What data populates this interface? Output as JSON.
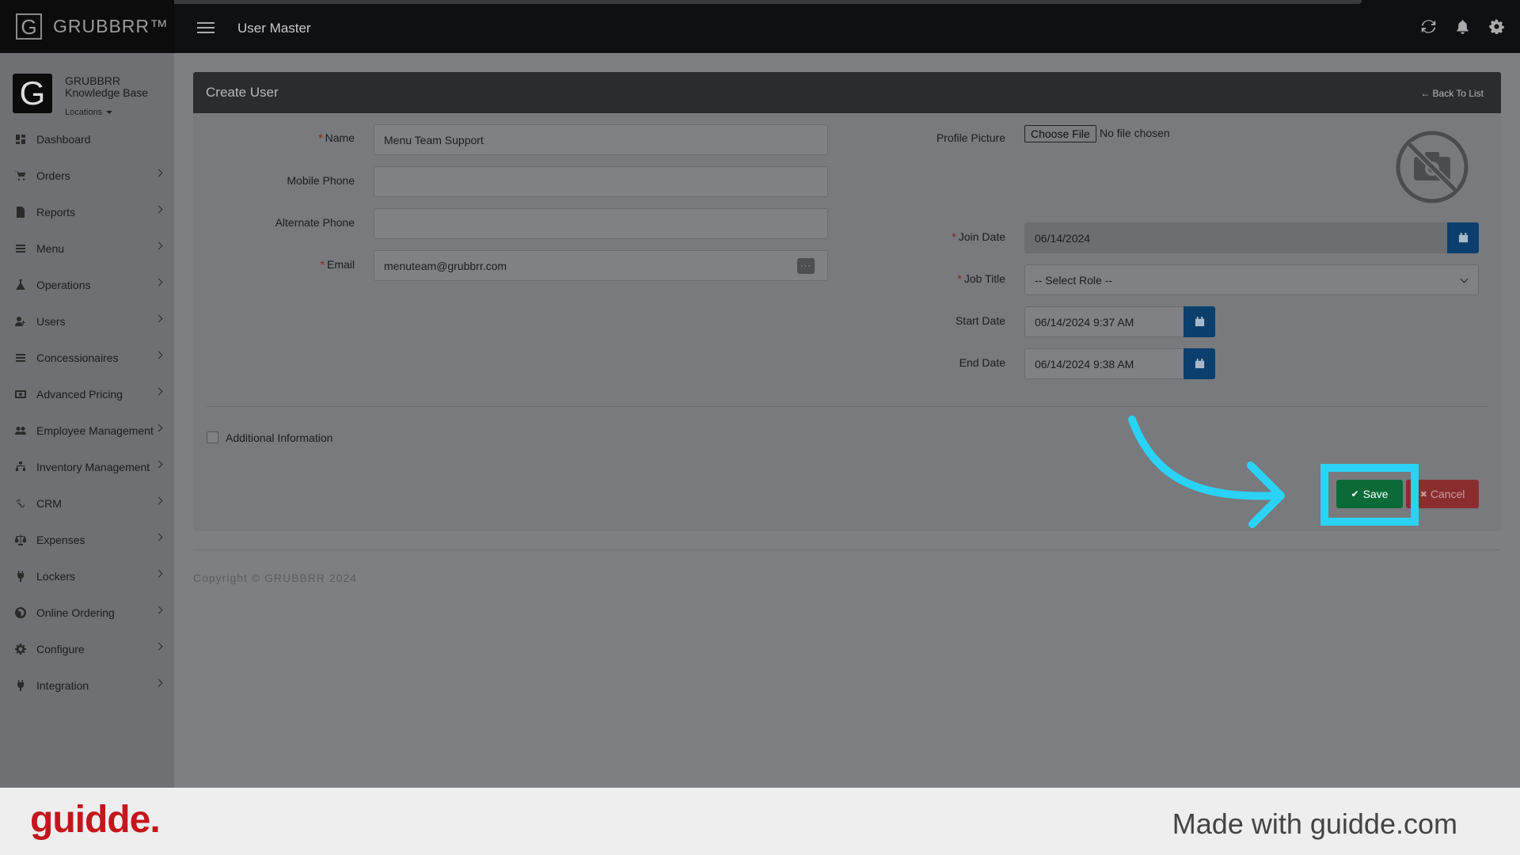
{
  "app": {
    "brand": "GRUBBRR™",
    "brand_letter": "G",
    "page_title": "User Master"
  },
  "profile": {
    "name_line1": "GRUBBRR",
    "name_line2": "Knowledge Base",
    "locations_label": "Locations"
  },
  "sidebar": {
    "items": [
      {
        "label": "Dashboard",
        "icon": "dashboard-icon",
        "has_children": false
      },
      {
        "label": "Orders",
        "icon": "cart-icon",
        "has_children": true
      },
      {
        "label": "Reports",
        "icon": "report-icon",
        "has_children": true
      },
      {
        "label": "Menu",
        "icon": "list-icon",
        "has_children": true
      },
      {
        "label": "Operations",
        "icon": "flask-icon",
        "has_children": true
      },
      {
        "label": "Users",
        "icon": "user-plus-icon",
        "has_children": true
      },
      {
        "label": "Concessionaires",
        "icon": "list-icon",
        "has_children": true
      },
      {
        "label": "Advanced Pricing",
        "icon": "money-icon",
        "has_children": true
      },
      {
        "label": "Employee Management",
        "icon": "users-icon",
        "has_children": true
      },
      {
        "label": "Inventory Management",
        "icon": "sitemap-icon",
        "has_children": true
      },
      {
        "label": "CRM",
        "icon": "link-icon",
        "has_children": true
      },
      {
        "label": "Expenses",
        "icon": "scale-icon",
        "has_children": true
      },
      {
        "label": "Lockers",
        "icon": "plug-icon",
        "has_children": true
      },
      {
        "label": "Online Ordering",
        "icon": "globe-icon",
        "has_children": true
      },
      {
        "label": "Configure",
        "icon": "gear-icon",
        "has_children": true
      },
      {
        "label": "Integration",
        "icon": "plug-icon",
        "has_children": true
      }
    ]
  },
  "form": {
    "title": "Create User",
    "back_label": "Back To List",
    "name": {
      "label": "Name",
      "value": "Menu Team Support"
    },
    "mobile_phone": {
      "label": "Mobile Phone",
      "value": ""
    },
    "alternate_phone": {
      "label": "Alternate Phone",
      "value": ""
    },
    "email": {
      "label": "Email",
      "value": "menuteam@grubbrr.com",
      "addon": "···"
    },
    "profile_picture": {
      "label": "Profile Picture",
      "button": "Choose File",
      "note": "No file chosen"
    },
    "join_date": {
      "label": "Join Date",
      "value": "06/14/2024"
    },
    "job_title": {
      "label": "Job Title",
      "value": "-- Select Role --"
    },
    "start_date": {
      "label": "Start Date",
      "value": "06/14/2024 9:37 AM"
    },
    "end_date": {
      "label": "End Date",
      "value": "06/14/2024 9:38 AM"
    },
    "additional_info_label": "Additional Information",
    "save_label": "Save",
    "cancel_label": "Cancel",
    "required_mark": "*"
  },
  "footer": {
    "copyright": "Copyright © GRUBBRR 2024"
  },
  "guidde": {
    "logo": "guidde.",
    "made_with": "Made with guidde.com"
  },
  "colors": {
    "highlight": "#2ad3f5",
    "save": "#0b6b38",
    "cancel": "#8a2d2f",
    "guidde_red": "#c4161c"
  }
}
